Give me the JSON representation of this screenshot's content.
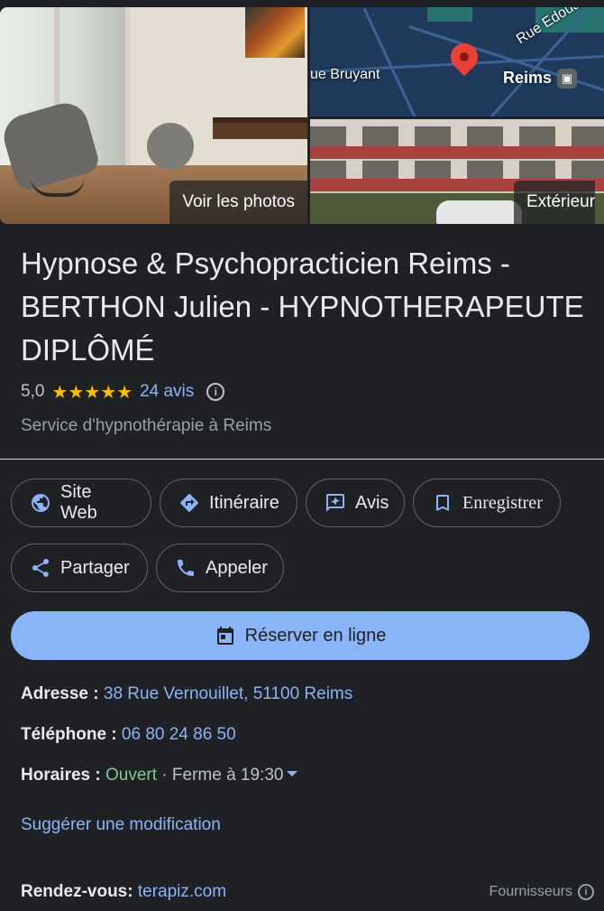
{
  "photos": {
    "main_label": "Voir les photos",
    "exterior_label": "Extérieur",
    "map": {
      "street_1": "ue Bruyant",
      "street_2": "Rue Edouard",
      "city": "Reims"
    }
  },
  "business": {
    "title": "Hypnose & Psychopracticien Reims - BERTHON Julien - HYPNOTHERAPEUTE DIPLÔMÉ",
    "rating": "5,0",
    "stars": "★★★★★",
    "stars_count": 5,
    "reviews": "24 avis",
    "category": "Service d'hypnothérapie à Reims"
  },
  "actions": {
    "website": "Site Web",
    "directions": "Itinéraire",
    "reviews": "Avis",
    "save": "Enregistrer",
    "share": "Partager",
    "call": "Appeler",
    "book": "Réserver en ligne"
  },
  "details": {
    "address_key": "Adresse : ",
    "address_value": "38 Rue Vernouillet, 51100 Reims",
    "phone_key": "Téléphone : ",
    "phone_value": "06 80 24 86 50",
    "hours_key": "Horaires : ",
    "hours_status": "Ouvert",
    "hours_close": " · Ferme à 19:30",
    "suggest": "Suggérer une modification",
    "appointment_key": "Rendez-vous: ",
    "appointment_value": "terapiz.com",
    "providers": "Fournisseurs"
  },
  "colors": {
    "background": "#202124",
    "link": "#8ab4f8",
    "open": "#81c995",
    "star": "#fbbc04",
    "book_button": "#8ab4f8"
  },
  "icons": [
    "globe-icon",
    "directions-icon",
    "review-icon",
    "bookmark-icon",
    "share-icon",
    "phone-icon",
    "calendar-icon",
    "info-icon",
    "train-icon",
    "map-pin-icon"
  ]
}
